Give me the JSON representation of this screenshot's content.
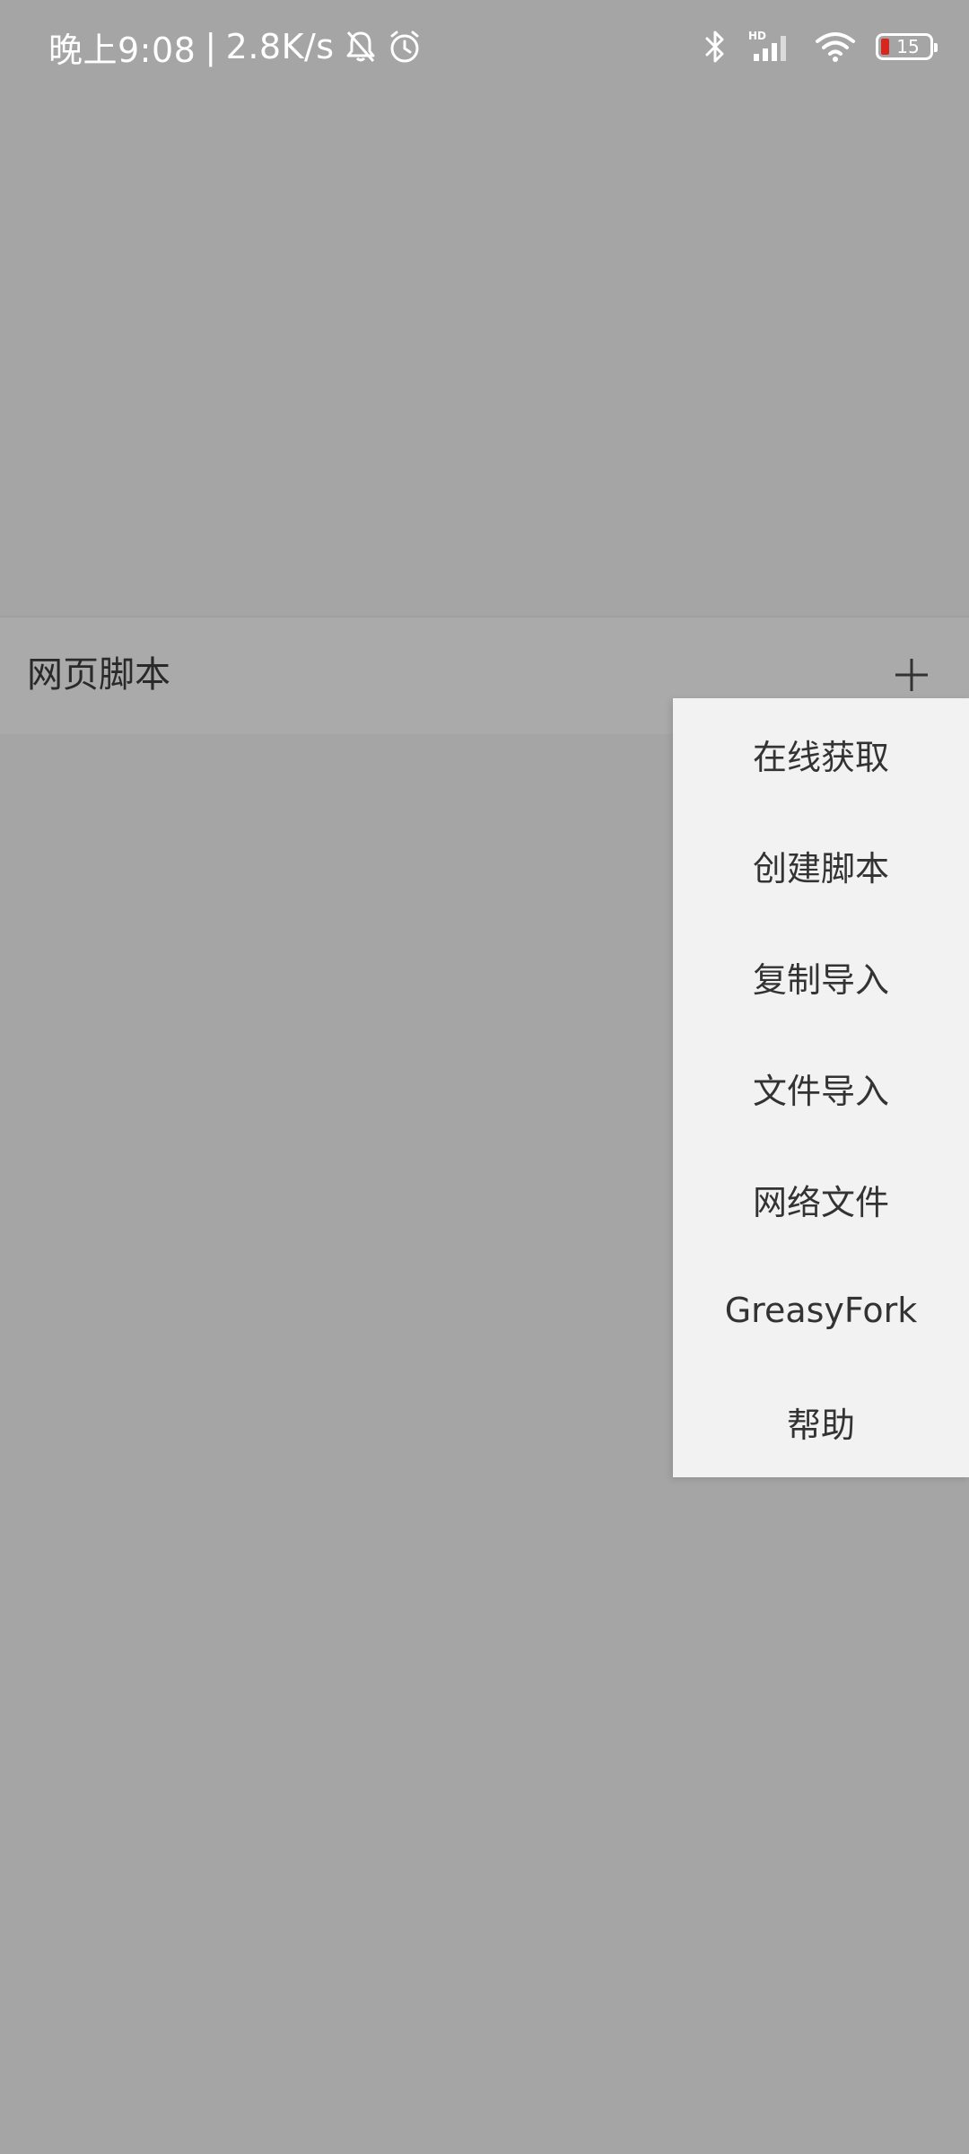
{
  "status_bar": {
    "time": "晚上9:08",
    "separator": "|",
    "net_speed": "2.8K/s",
    "battery_level": "15",
    "icons": [
      "bell-off-icon",
      "alarm-icon",
      "bluetooth-icon",
      "signal-hd-icon",
      "wifi-icon",
      "battery-icon"
    ],
    "battery_low_color": "#d8261f"
  },
  "header": {
    "title": "网页脚本",
    "add_icon": "plus-icon"
  },
  "menu": {
    "items": [
      {
        "label": "在线获取"
      },
      {
        "label": "创建脚本"
      },
      {
        "label": "复制导入"
      },
      {
        "label": "文件导入"
      },
      {
        "label": "网络文件"
      },
      {
        "label": "GreasyFork"
      },
      {
        "label": "帮助"
      }
    ]
  },
  "colors": {
    "overlay_background": "#a5a5a5",
    "menu_background": "#f2f2f2",
    "text_dark": "#333333"
  }
}
